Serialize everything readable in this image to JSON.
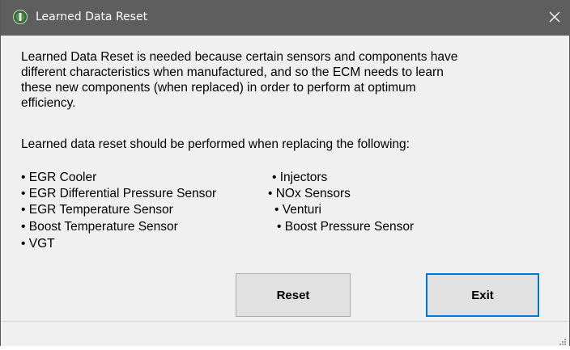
{
  "window": {
    "title": "Learned Data Reset",
    "close_glyph": "✕"
  },
  "description": {
    "lines": [
      "Learned Data Reset is needed because certain sensors and components have",
      "different characteristics when manufactured, and so the ECM needs to learn",
      "these new components (when replaced) in order to perform at optimum",
      "efficiency."
    ],
    "instruction": "Learned data reset should be performed when replacing the following:"
  },
  "components": {
    "left": [
      "• EGR Cooler",
      "• EGR Differential Pressure Sensor",
      "• EGR Temperature Sensor",
      "• Boost Temperature Sensor",
      "• VGT"
    ],
    "right": [
      "• Injectors",
      "• NOx Sensors",
      "• Venturi",
      "• Boost Pressure Sensor"
    ]
  },
  "buttons": {
    "reset_label": "Reset",
    "exit_label": "Exit"
  },
  "colors": {
    "titlebar": "#5e5e5e",
    "background": "#f0f0f0",
    "button": "#e1e1e1",
    "focus_border": "#0078d7"
  },
  "icons": {
    "app": "app-logo-icon",
    "close": "close-icon",
    "resize": "resize-grip-icon"
  }
}
